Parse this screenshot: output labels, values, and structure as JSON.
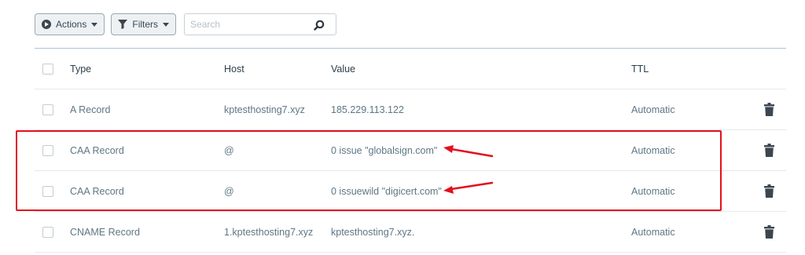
{
  "toolbar": {
    "actions_label": "Actions",
    "filters_label": "Filters",
    "search_placeholder": "Search"
  },
  "table": {
    "columns": {
      "type": "Type",
      "host": "Host",
      "value": "Value",
      "ttl": "TTL"
    },
    "rows": [
      {
        "type": "A Record",
        "host": "kptesthosting7.xyz",
        "value": "185.229.113.122",
        "ttl": "Automatic"
      },
      {
        "type": "CAA Record",
        "host": "@",
        "value": "0 issue \"globalsign.com\"",
        "ttl": "Automatic"
      },
      {
        "type": "CAA Record",
        "host": "@",
        "value": "0 issuewild \"digicert.com\"",
        "ttl": "Automatic"
      },
      {
        "type": "CNAME Record",
        "host": "1.kptesthosting7.xyz",
        "value": "kptesthosting7.xyz.",
        "ttl": "Automatic"
      }
    ]
  },
  "colors": {
    "annotation_red": "#e3101d",
    "table_text": "#5e7785",
    "header_border": "#a9c6d1"
  }
}
